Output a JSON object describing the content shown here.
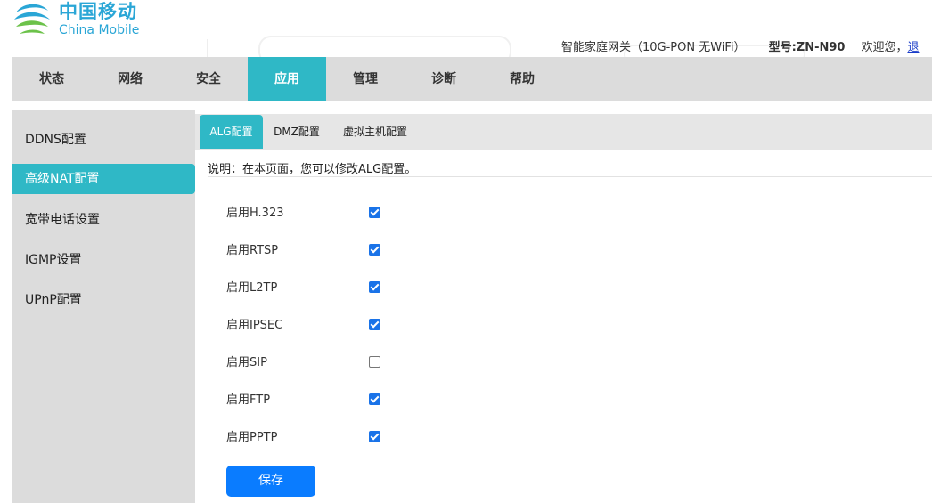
{
  "header": {
    "logo_cn": "中国移动",
    "logo_en": "China Mobile",
    "device_name": "智能家庭网关（10G-PON 无WiFi）",
    "model": "型号:ZN-N90",
    "welcome": "欢迎您，",
    "logout": "退"
  },
  "topnav": [
    "状态",
    "网络",
    "安全",
    "应用",
    "管理",
    "诊断",
    "帮助"
  ],
  "topnav_active": "应用",
  "sidebar": [
    "DDNS配置",
    "高级NAT配置",
    "宽带电话设置",
    "IGMP设置",
    "UPnP配置"
  ],
  "sidebar_active": "高级NAT配置",
  "subtabs": [
    "ALG配置",
    "DMZ配置",
    "虚拟主机配置"
  ],
  "subtab_active": "ALG配置",
  "description": "说明：在本页面，您可以修改ALG配置。",
  "options": [
    {
      "label": "启用H.323",
      "checked": true
    },
    {
      "label": "启用RTSP",
      "checked": true
    },
    {
      "label": "启用L2TP",
      "checked": true
    },
    {
      "label": "启用IPSEC",
      "checked": true
    },
    {
      "label": "启用SIP",
      "checked": false
    },
    {
      "label": "启用FTP",
      "checked": true
    },
    {
      "label": "启用PPTP",
      "checked": true
    }
  ],
  "save_label": "保存",
  "colors": {
    "accent": "#2fb8c6",
    "button": "#0a7cff",
    "brand": "#2aa6d6"
  }
}
